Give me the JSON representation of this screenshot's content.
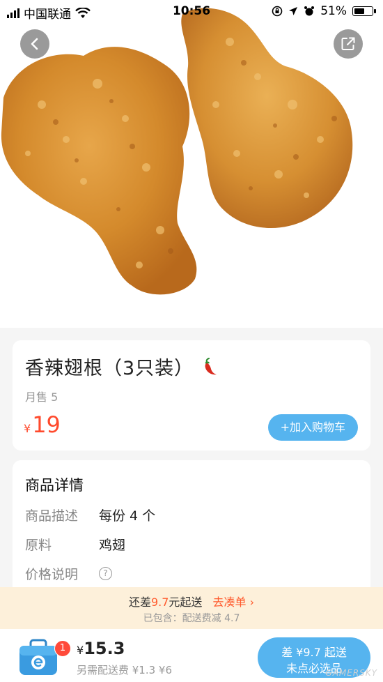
{
  "status_bar": {
    "carrier": "中国联通",
    "time": "10:56",
    "battery": "51%",
    "battery_level": 0.51
  },
  "product": {
    "name": "香辣翅根（3只装）",
    "spicy_icon": "chili-pepper-icon",
    "monthly_sales": "月售 5",
    "currency": "¥",
    "price": "19",
    "add_to_cart": "+加入购物车"
  },
  "details": {
    "title": "商品详情",
    "rows": [
      {
        "label": "商品描述",
        "value": "每份 4 个"
      },
      {
        "label": "原料",
        "value": "鸡翅"
      },
      {
        "label": "价格说明",
        "value": ""
      }
    ]
  },
  "delivery_banner": {
    "prefix": "还差",
    "amount": "9.7",
    "suffix": "元起送",
    "action": "去凑单",
    "included": "已包含：配送费减 4.7"
  },
  "bottom_bar": {
    "badge": "1",
    "currency": "¥",
    "total": "15.3",
    "extra_fee": "另需配送费 ¥1.3 ¥6",
    "checkout_line1": "差 ¥9.7 起送",
    "checkout_line2": "未点必选品"
  },
  "watermark": "GAMERSKY",
  "colors": {
    "accent_blue": "#56b4ef",
    "price_red": "#ff4a2d",
    "banner_bg": "#fdf0da"
  }
}
